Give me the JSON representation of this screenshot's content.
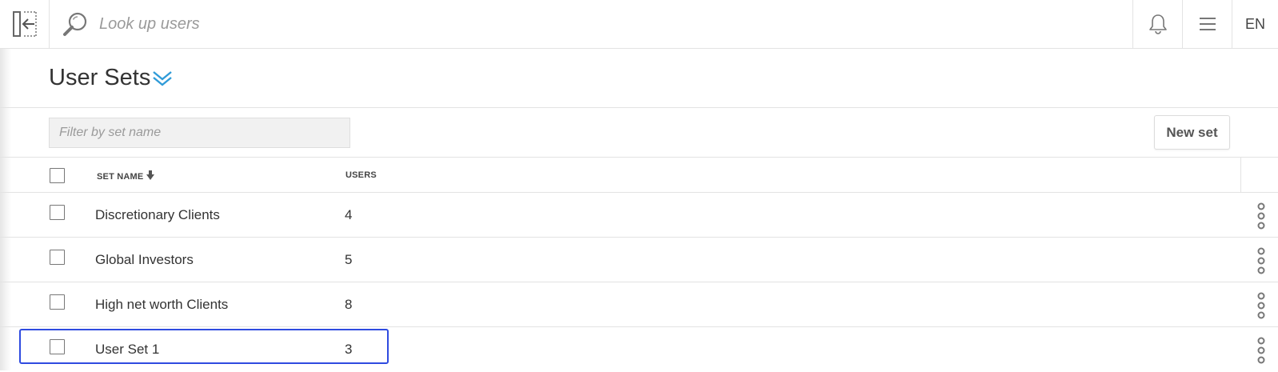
{
  "topbar": {
    "search_placeholder": "Look up users",
    "language": "EN"
  },
  "page": {
    "title": "User Sets"
  },
  "toolbar": {
    "filter_placeholder": "Filter by set name",
    "new_set_label": "New set"
  },
  "table": {
    "columns": [
      "SET NAME",
      "USERS"
    ],
    "sort": {
      "column": "SET NAME",
      "direction": "descending"
    },
    "rows": [
      {
        "name": "Discretionary Clients",
        "users": "4"
      },
      {
        "name": "Global Investors",
        "users": "5"
      },
      {
        "name": "High net worth Clients",
        "users": "8"
      },
      {
        "name": "User Set 1",
        "users": "3",
        "focused": true
      }
    ]
  },
  "colors": {
    "accent": "#2f9bd8",
    "focus_outline": "#2f4be0",
    "border": "#e3e3e3"
  },
  "icons": {
    "collapse": "sidebar-collapse-icon",
    "search": "magnifier-icon",
    "notifications": "bell-icon",
    "menu": "hamburger-icon",
    "title_dropdown": "double-chevron-down-icon",
    "sort": "arrow-down-icon",
    "row_actions": "vertical-dots-icon"
  }
}
